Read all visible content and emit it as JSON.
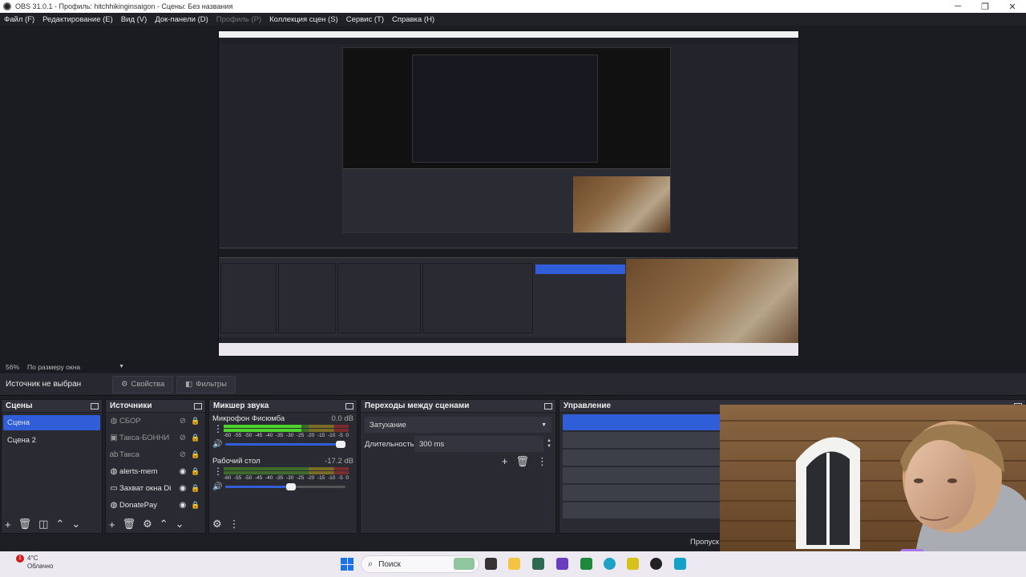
{
  "window": {
    "title": "OBS 31.0.1 - Профиль: hitchhikinginsaigon - Сцены: Без названия",
    "controls": [
      "─",
      "❐",
      "✕"
    ]
  },
  "menu": [
    {
      "label": "Файл (F)",
      "disabled": false
    },
    {
      "label": "Редактирование (E)",
      "disabled": false
    },
    {
      "label": "Вид (V)",
      "disabled": false
    },
    {
      "label": "Док-панели (D)",
      "disabled": false
    },
    {
      "label": "Профиль (P)",
      "disabled": true
    },
    {
      "label": "Коллекция сцен (S)",
      "disabled": false
    },
    {
      "label": "Сервис (T)",
      "disabled": false
    },
    {
      "label": "Справка (H)",
      "disabled": false
    }
  ],
  "zoom": {
    "percent": "56%",
    "mode": "По размеру окна"
  },
  "source_bar": {
    "no_source": "Источник не выбран",
    "properties": "Свойства",
    "filters": "Фильтры"
  },
  "scenes": {
    "title": "Сцены",
    "items": [
      {
        "label": "Сцена",
        "active": true
      },
      {
        "label": "Сцена 2",
        "active": false
      }
    ]
  },
  "sources": {
    "title": "Источники",
    "items": [
      {
        "label": "СБОР",
        "icon": "browser-icon",
        "visible": false
      },
      {
        "label": "Такса-БОННИ",
        "icon": "image-icon",
        "visible": false
      },
      {
        "label": "Такса",
        "icon": "text-icon",
        "visible": false
      },
      {
        "label": "alerts-mem",
        "icon": "browser-icon",
        "visible": true
      },
      {
        "label": "Захват окна Di",
        "icon": "window-capture-icon",
        "visible": true
      },
      {
        "label": "DonatePay",
        "icon": "browser-icon",
        "visible": true
      }
    ]
  },
  "mixer": {
    "title": "Микшер звука",
    "ticks": [
      "-60",
      "-55",
      "-50",
      "-45",
      "-40",
      "-35",
      "-30",
      "-25",
      "-20",
      "-15",
      "-10",
      "-5",
      "0"
    ],
    "channels": [
      {
        "name": "Микрофон Фисюмба",
        "db": "0.0 dB",
        "level": 0.62,
        "volume": 1.0
      },
      {
        "name": "Рабочий стол",
        "db": "-17.2 dB",
        "level": 0.0,
        "volume": 0.55
      }
    ]
  },
  "transitions": {
    "title": "Переходы между сценами",
    "selected": "Затухание",
    "duration_label": "Длительность",
    "duration_value": "300 ms"
  },
  "controls": {
    "title": "Управление"
  },
  "status": {
    "skip": "Пропуск"
  },
  "taskbar": {
    "weather_badge": "1",
    "temp": "4°C",
    "desc": "Облачно",
    "search": "Поиск"
  },
  "colors": {
    "accent": "#2f5ed8",
    "panel": "#2a2b32",
    "background": "#1e1f25"
  }
}
